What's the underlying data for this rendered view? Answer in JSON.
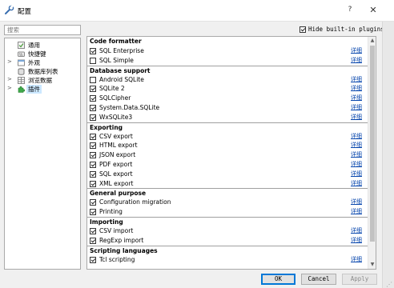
{
  "window": {
    "title": "配置",
    "help": "?",
    "close": "✕"
  },
  "search": {
    "placeholder": "搜索"
  },
  "categories": [
    {
      "label": "通用",
      "icon": "general-settings-icon",
      "arrow": ""
    },
    {
      "label": "快捷键",
      "icon": "shortcuts-icon",
      "arrow": ""
    },
    {
      "label": "外观",
      "icon": "appearance-icon",
      "arrow": ">"
    },
    {
      "label": "数据库列表",
      "icon": "database-list-icon",
      "arrow": ""
    },
    {
      "label": "浏览数据",
      "icon": "browse-data-icon",
      "arrow": ">"
    },
    {
      "label": "插件",
      "icon": "plugins-icon",
      "arrow": ">",
      "selected": true
    }
  ],
  "hide_builtin": {
    "label": "Hide built-in plugins",
    "checked": true
  },
  "plugin_groups": [
    {
      "name": "Code formatter",
      "items": [
        {
          "name": "SQL Enterprise",
          "checked": true,
          "details": "详细"
        },
        {
          "name": "SQL Simple",
          "checked": false,
          "details": "详细"
        }
      ]
    },
    {
      "name": "Database support",
      "items": [
        {
          "name": "Android SQLite",
          "checked": false,
          "details": "详细"
        },
        {
          "name": "SQLite 2",
          "checked": true,
          "details": "详细"
        },
        {
          "name": "SQLCipher",
          "checked": true,
          "details": "详细"
        },
        {
          "name": "System.Data.SQLite",
          "checked": true,
          "details": "详细"
        },
        {
          "name": "WxSQLite3",
          "checked": true,
          "details": "详细"
        }
      ]
    },
    {
      "name": "Exporting",
      "items": [
        {
          "name": "CSV export",
          "checked": true,
          "details": "详细"
        },
        {
          "name": "HTML export",
          "checked": true,
          "details": "详细"
        },
        {
          "name": "JSON export",
          "checked": true,
          "details": "详细"
        },
        {
          "name": "PDF export",
          "checked": true,
          "details": "详细"
        },
        {
          "name": "SQL export",
          "checked": true,
          "details": "详细"
        },
        {
          "name": "XML export",
          "checked": true,
          "details": "详细"
        }
      ]
    },
    {
      "name": "General purpose",
      "items": [
        {
          "name": "Configuration migration",
          "checked": true,
          "details": "详细"
        },
        {
          "name": "Printing",
          "checked": true,
          "details": "详细"
        }
      ]
    },
    {
      "name": "Importing",
      "items": [
        {
          "name": "CSV import",
          "checked": true,
          "details": "详细"
        },
        {
          "name": "RegExp import",
          "checked": true,
          "details": "详细"
        }
      ]
    },
    {
      "name": "Scripting languages",
      "items": [
        {
          "name": "Tcl scripting",
          "checked": true,
          "details": "详细"
        }
      ]
    }
  ],
  "buttons": {
    "ok": "OK",
    "cancel": "Cancel",
    "apply": "Apply"
  },
  "colors": {
    "selection": "#cce8ff",
    "link": "#0645ad",
    "default_button_border": "#0078d7"
  }
}
